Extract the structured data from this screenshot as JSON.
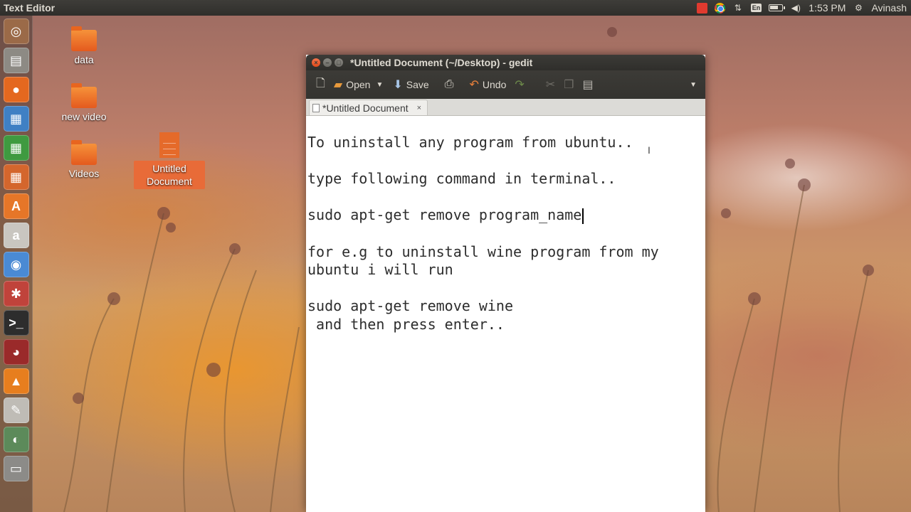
{
  "top_panel": {
    "app_title": "Text Editor",
    "clock": "1:53 PM",
    "user": "Avinash",
    "keyboard_layout": "En",
    "icons": [
      "indicator-red-icon",
      "chrome-icon",
      "network-icon",
      "keyboard-icon",
      "battery-icon",
      "volume-icon",
      "settings-gear-icon"
    ]
  },
  "launcher": {
    "items": [
      {
        "name": "ubuntu-dash-icon",
        "glyph": "◎",
        "bg": "#9b6a48"
      },
      {
        "name": "files-icon",
        "glyph": "▤",
        "bg": "#8d8a84"
      },
      {
        "name": "firefox-icon",
        "glyph": "●",
        "bg": "#e4681f"
      },
      {
        "name": "libreoffice-writer-icon",
        "glyph": "▦",
        "bg": "#3f80c4"
      },
      {
        "name": "libreoffice-calc-icon",
        "glyph": "▦",
        "bg": "#3f9a40"
      },
      {
        "name": "libreoffice-impress-icon",
        "glyph": "▦",
        "bg": "#d4662d"
      },
      {
        "name": "software-center-icon",
        "glyph": "A",
        "bg": "#e67628"
      },
      {
        "name": "amazon-icon",
        "glyph": "a",
        "bg": "#c9c6c0"
      },
      {
        "name": "chromium-icon",
        "glyph": "◉",
        "bg": "#4a8ad4"
      },
      {
        "name": "system-settings-icon",
        "glyph": "✱",
        "bg": "#c0433b"
      },
      {
        "name": "terminal-icon",
        "glyph": ">_",
        "bg": "#2d2d2d"
      },
      {
        "name": "app-red-icon",
        "glyph": "◕",
        "bg": "#9a2a2a"
      },
      {
        "name": "vlc-icon",
        "glyph": "▲",
        "bg": "#e77e1e"
      },
      {
        "name": "text-editor-icon",
        "glyph": "✎",
        "bg": "#bfbcb6"
      },
      {
        "name": "system-monitor-icon",
        "glyph": "◐",
        "bg": "#5c8a5a"
      },
      {
        "name": "drive-icon",
        "glyph": "▭",
        "bg": "#8c8b88"
      }
    ]
  },
  "desktop": {
    "icons": [
      {
        "label": "data",
        "kind": "folder"
      },
      {
        "label": "new video",
        "kind": "folder"
      },
      {
        "label": "Videos",
        "kind": "folder"
      },
      {
        "label_line1": "Untitled",
        "label_line2": "Document",
        "kind": "document"
      }
    ]
  },
  "window": {
    "title": "*Untitled Document (~/Desktop) - gedit",
    "toolbar": {
      "open_label": "Open",
      "save_label": "Save",
      "undo_label": "Undo"
    },
    "tab": {
      "label": "*Untitled Document",
      "close": "×"
    },
    "editor": {
      "lines": [
        "To uninstall any program from ubuntu..",
        "",
        "type following command in terminal..",
        "",
        "sudo apt-get remove program_name",
        "",
        "for e.g to uninstall wine program from my",
        "ubuntu i will run",
        "",
        "sudo apt-get remove wine",
        " and then press enter.."
      ]
    }
  }
}
